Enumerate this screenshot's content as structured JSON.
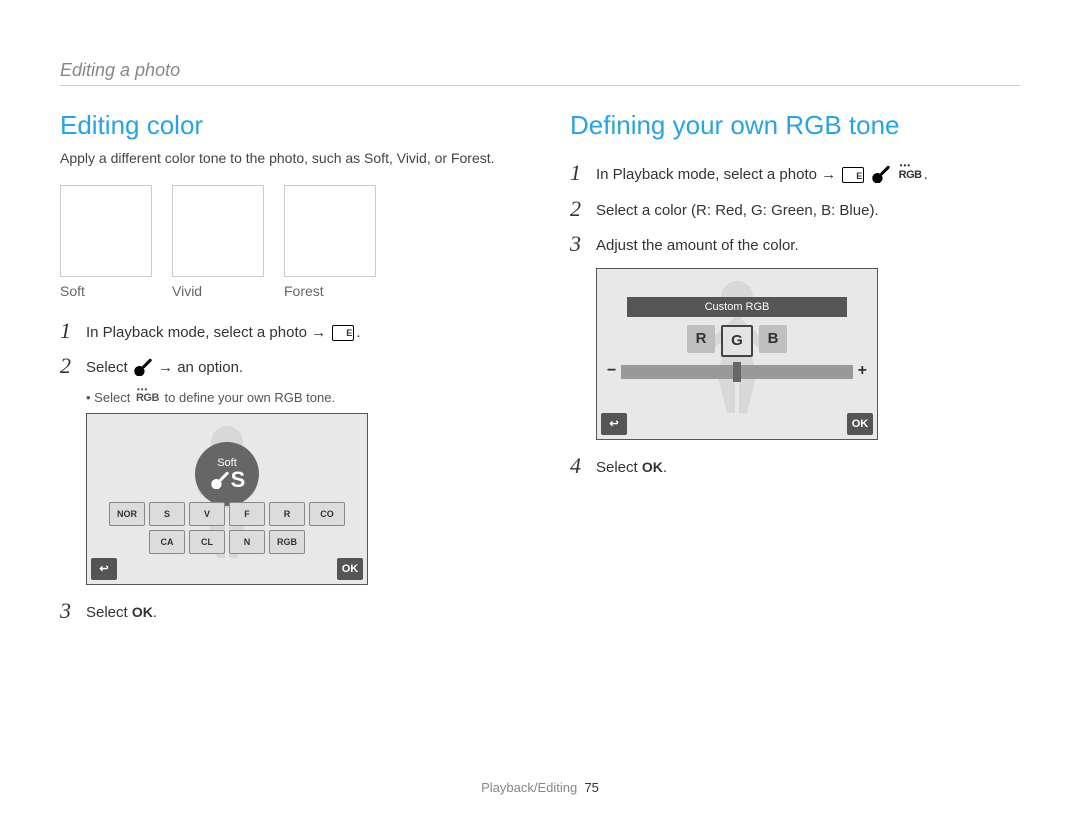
{
  "breadcrumb": "Editing a photo",
  "left": {
    "title": "Editing color",
    "intro": "Apply a different color tone to the photo, such as Soft, Vivid, or Forest.",
    "swatches": [
      "Soft",
      "Vivid",
      "Forest"
    ],
    "steps": {
      "s1": "In Playback mode, select a photo →",
      "s2_pre": "Select",
      "s2_mid": "→ an option.",
      "s2_sub_pre": "Select",
      "s2_sub_post": "to define your own RGB tone.",
      "s3_pre": "Select",
      "s3_ok": "OK",
      "s3_post": "."
    },
    "screen": {
      "bubble_label": "Soft",
      "bubble_glyph": "S",
      "tools_row1": [
        "NOR",
        "S",
        "V",
        "F",
        "R",
        "CO"
      ],
      "tools_row2": [
        "CA",
        "CL",
        "N",
        "RGB"
      ],
      "back": "↩",
      "ok": "OK"
    }
  },
  "right": {
    "title": "Defining your own RGB tone",
    "steps": {
      "s1_pre": "In Playback mode, select a photo →",
      "s1_post": ".",
      "s2": "Select a color (R: Red, G: Green, B: Blue).",
      "s3": "Adjust the amount of the color.",
      "s4_pre": "Select",
      "s4_ok": "OK",
      "s4_post": "."
    },
    "screen": {
      "title": "Custom RGB",
      "R": "R",
      "G": "G",
      "B": "B",
      "minus": "−",
      "plus": "+",
      "back": "↩",
      "ok": "OK"
    }
  },
  "footer": {
    "section": "Playback/Editing",
    "page": "75"
  },
  "icons": {
    "rgb_label": "RGB"
  }
}
